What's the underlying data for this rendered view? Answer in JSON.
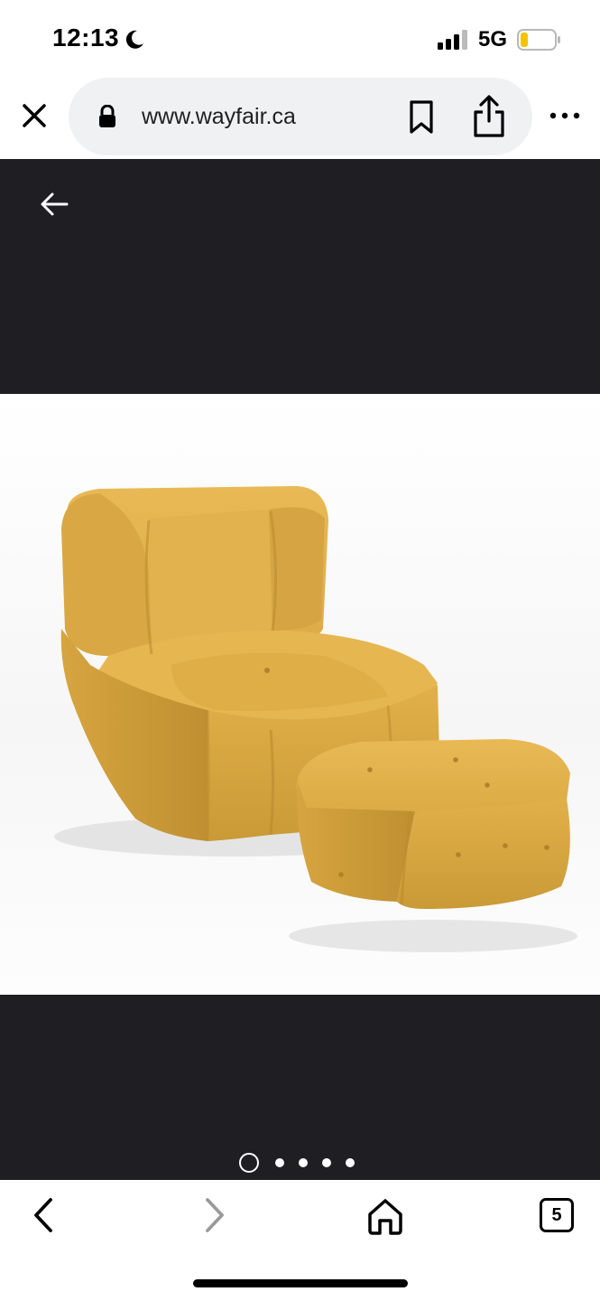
{
  "status_bar": {
    "time": "12:13",
    "network": "5G",
    "icons": [
      "moon-icon",
      "signal-icon",
      "battery-icon"
    ],
    "battery_color": "#f5c400"
  },
  "browser": {
    "url": "www.wayfair.ca",
    "icons": [
      "close-icon",
      "lock-icon",
      "bookmark-icon",
      "share-icon",
      "more-icon"
    ]
  },
  "viewer": {
    "background": "#1f1e23",
    "image_alt": "yellow bouclé lounge chair with ottoman",
    "page_count": 5,
    "current_page": 1,
    "accent": "#d9a93c"
  },
  "toolbar": {
    "tab_count": "5",
    "icons": [
      "back-icon",
      "forward-icon",
      "home-icon",
      "tabs-icon"
    ]
  }
}
